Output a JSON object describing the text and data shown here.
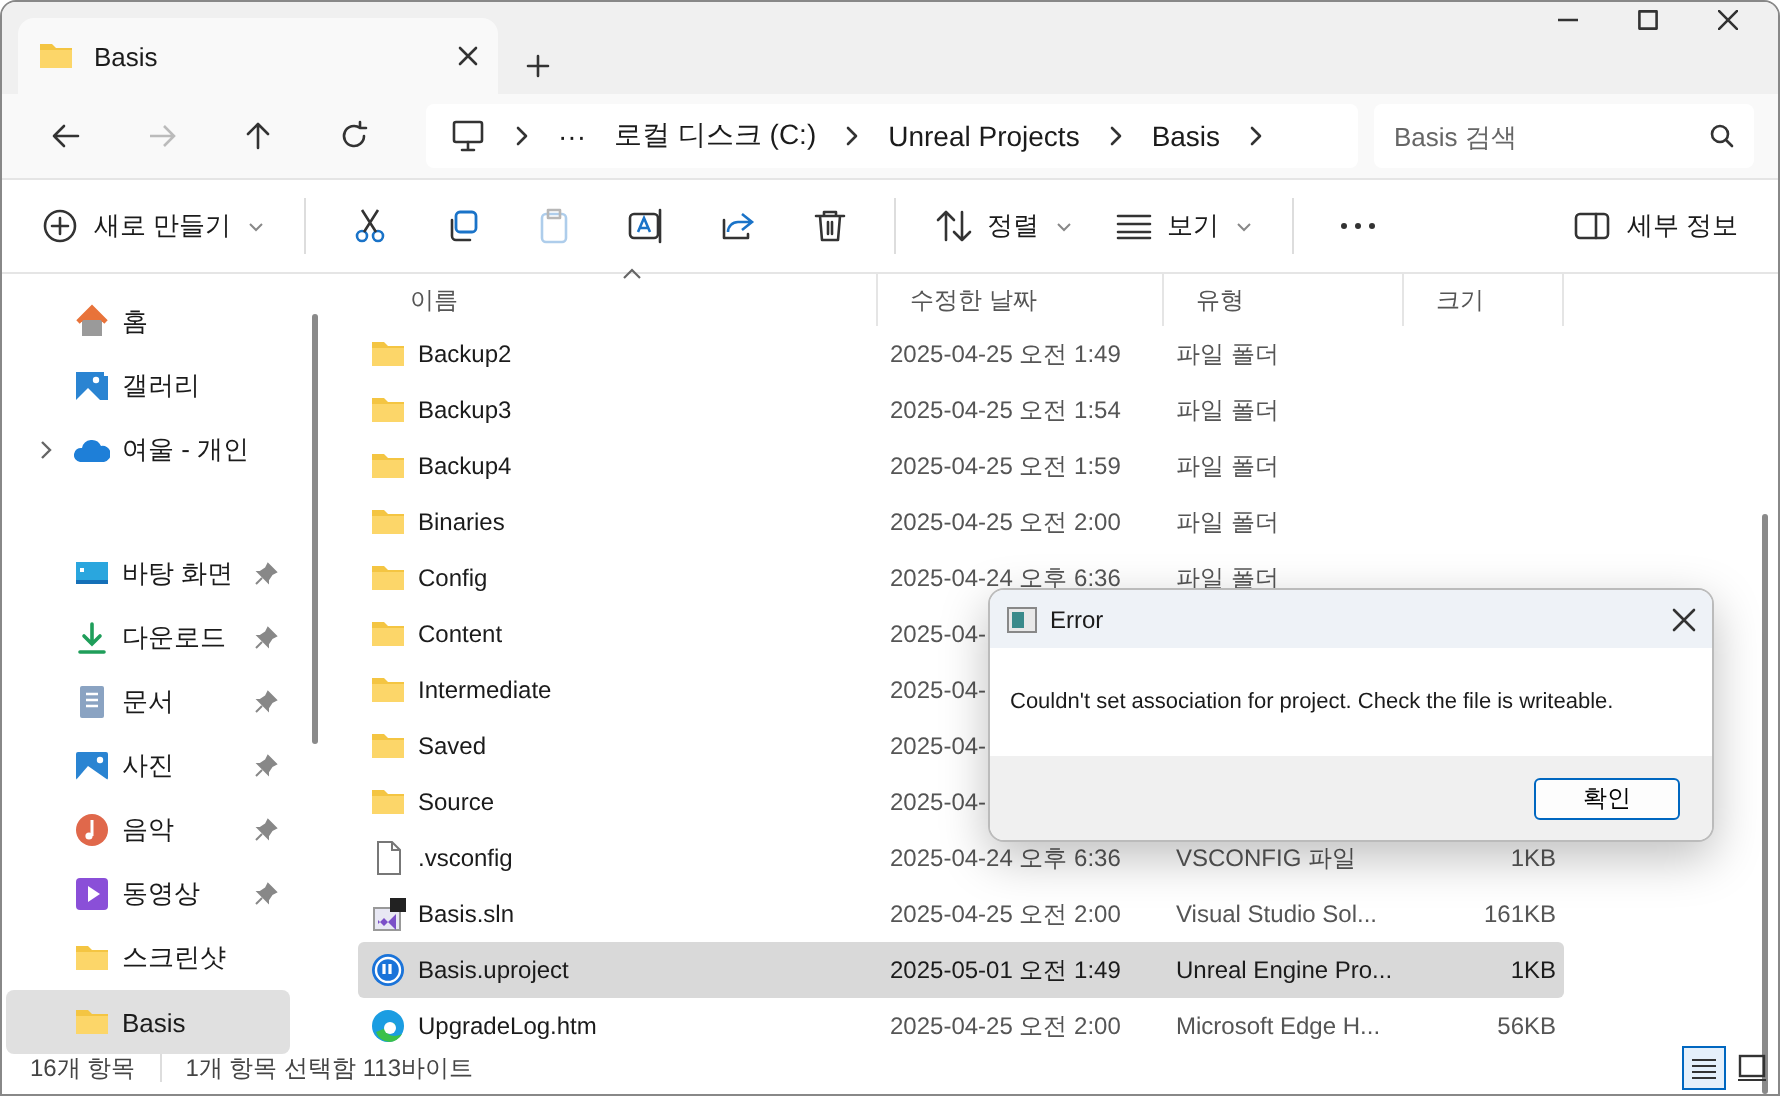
{
  "window": {
    "tab": {
      "title": "Basis"
    }
  },
  "nav": {
    "overflow": "···",
    "breadcrumb": [
      "로컬 디스크 (C:)",
      "Unreal Projects",
      "Basis"
    ],
    "search": {
      "placeholder": "Basis 검색"
    }
  },
  "commands": [
    {
      "kind": "new",
      "label": "새로 만들기",
      "disabled": false
    },
    {
      "kind": "cut",
      "disabled": false
    },
    {
      "kind": "copy",
      "disabled": false
    },
    {
      "kind": "paste",
      "disabled": true
    },
    {
      "kind": "rename",
      "disabled": false
    },
    {
      "kind": "share",
      "disabled": false
    },
    {
      "kind": "delete",
      "disabled": false
    },
    {
      "kind": "sort",
      "label": "정렬",
      "disabled": false
    },
    {
      "kind": "view",
      "label": "보기",
      "disabled": false
    },
    {
      "kind": "more",
      "disabled": false
    },
    {
      "kind": "details",
      "label": "세부 정보",
      "disabled": false
    }
  ],
  "sidebar": {
    "groups": [
      [
        {
          "kind": "home",
          "label": "홈",
          "pinned": false,
          "expandable": false,
          "selected": false
        },
        {
          "kind": "gallery",
          "label": "갤러리",
          "pinned": false,
          "expandable": false,
          "selected": false
        },
        {
          "kind": "cloud",
          "label": "여울 - 개인",
          "pinned": false,
          "expandable": true,
          "selected": false
        }
      ],
      [
        {
          "kind": "desktop",
          "label": "바탕 화면",
          "pinned": true,
          "expandable": false,
          "selected": false
        },
        {
          "kind": "download",
          "label": "다운로드",
          "pinned": true,
          "expandable": false,
          "selected": false
        },
        {
          "kind": "documents",
          "label": "문서",
          "pinned": true,
          "expandable": false,
          "selected": false
        },
        {
          "kind": "pictures",
          "label": "사진",
          "pinned": true,
          "expandable": false,
          "selected": false
        },
        {
          "kind": "music",
          "label": "음악",
          "pinned": true,
          "expandable": false,
          "selected": false
        },
        {
          "kind": "videos",
          "label": "동영상",
          "pinned": true,
          "expandable": false,
          "selected": false
        },
        {
          "kind": "folder",
          "label": "스크린샷",
          "pinned": false,
          "expandable": false,
          "selected": false
        },
        {
          "kind": "folder",
          "label": "Basis",
          "pinned": false,
          "expandable": false,
          "selected": true
        }
      ]
    ]
  },
  "table": {
    "columns": [
      {
        "label": "이름",
        "sorted": true
      },
      {
        "label": "수정한 날짜",
        "sorted": false
      },
      {
        "label": "유형",
        "sorted": false
      },
      {
        "label": "크기",
        "sorted": false
      }
    ],
    "rows": [
      {
        "kind": "folder",
        "name": "Backup2",
        "date": "2025-04-25 오전 1:49",
        "type": "파일 폴더",
        "selected": false
      },
      {
        "kind": "folder",
        "name": "Backup3",
        "date": "2025-04-25 오전 1:54",
        "type": "파일 폴더",
        "selected": false
      },
      {
        "kind": "folder",
        "name": "Backup4",
        "date": "2025-04-25 오전 1:59",
        "type": "파일 폴더",
        "selected": false
      },
      {
        "kind": "folder",
        "name": "Binaries",
        "date": "2025-04-25 오전 2:00",
        "type": "파일 폴더",
        "selected": false
      },
      {
        "kind": "folder",
        "name": "Config",
        "date": "2025-04-24 오후 6:36",
        "type": "파일 폴더",
        "selected": false
      },
      {
        "kind": "folder",
        "name": "Content",
        "date": "2025-04-",
        "selected": false
      },
      {
        "kind": "folder",
        "name": "Intermediate",
        "date": "2025-04-",
        "selected": false
      },
      {
        "kind": "folder",
        "name": "Saved",
        "date": "2025-04-",
        "selected": false
      },
      {
        "kind": "folder",
        "name": "Source",
        "date": "2025-04-",
        "selected": false
      },
      {
        "kind": "file",
        "name": ".vsconfig",
        "date": "2025-04-24 오후 6:36",
        "type": "VSCONFIG 파일",
        "size": "1KB",
        "selected": false
      },
      {
        "kind": "sln",
        "name": "Basis.sln",
        "date": "2025-04-25 오전 2:00",
        "type": "Visual Studio Sol...",
        "size": "161KB",
        "selected": false
      },
      {
        "kind": "uproject",
        "name": "Basis.uproject",
        "date": "2025-05-01 오전 1:49",
        "type": "Unreal Engine Pro...",
        "size": "1KB",
        "selected": true
      },
      {
        "kind": "edge",
        "name": "UpgradeLog.htm",
        "date": "2025-04-25 오전 2:00",
        "type": "Microsoft Edge H...",
        "size": "56KB",
        "selected": false
      }
    ]
  },
  "status_bar": {
    "count": "16개 항목",
    "selection": "1개 항목 선택함 113바이트",
    "views": [
      {
        "kind": "details",
        "selected": true
      },
      {
        "kind": "tiles",
        "selected": false
      }
    ]
  },
  "dialog": {
    "title": "Error",
    "message": "Couldn't set association for project. Check the file is writeable.",
    "button": "확인"
  }
}
